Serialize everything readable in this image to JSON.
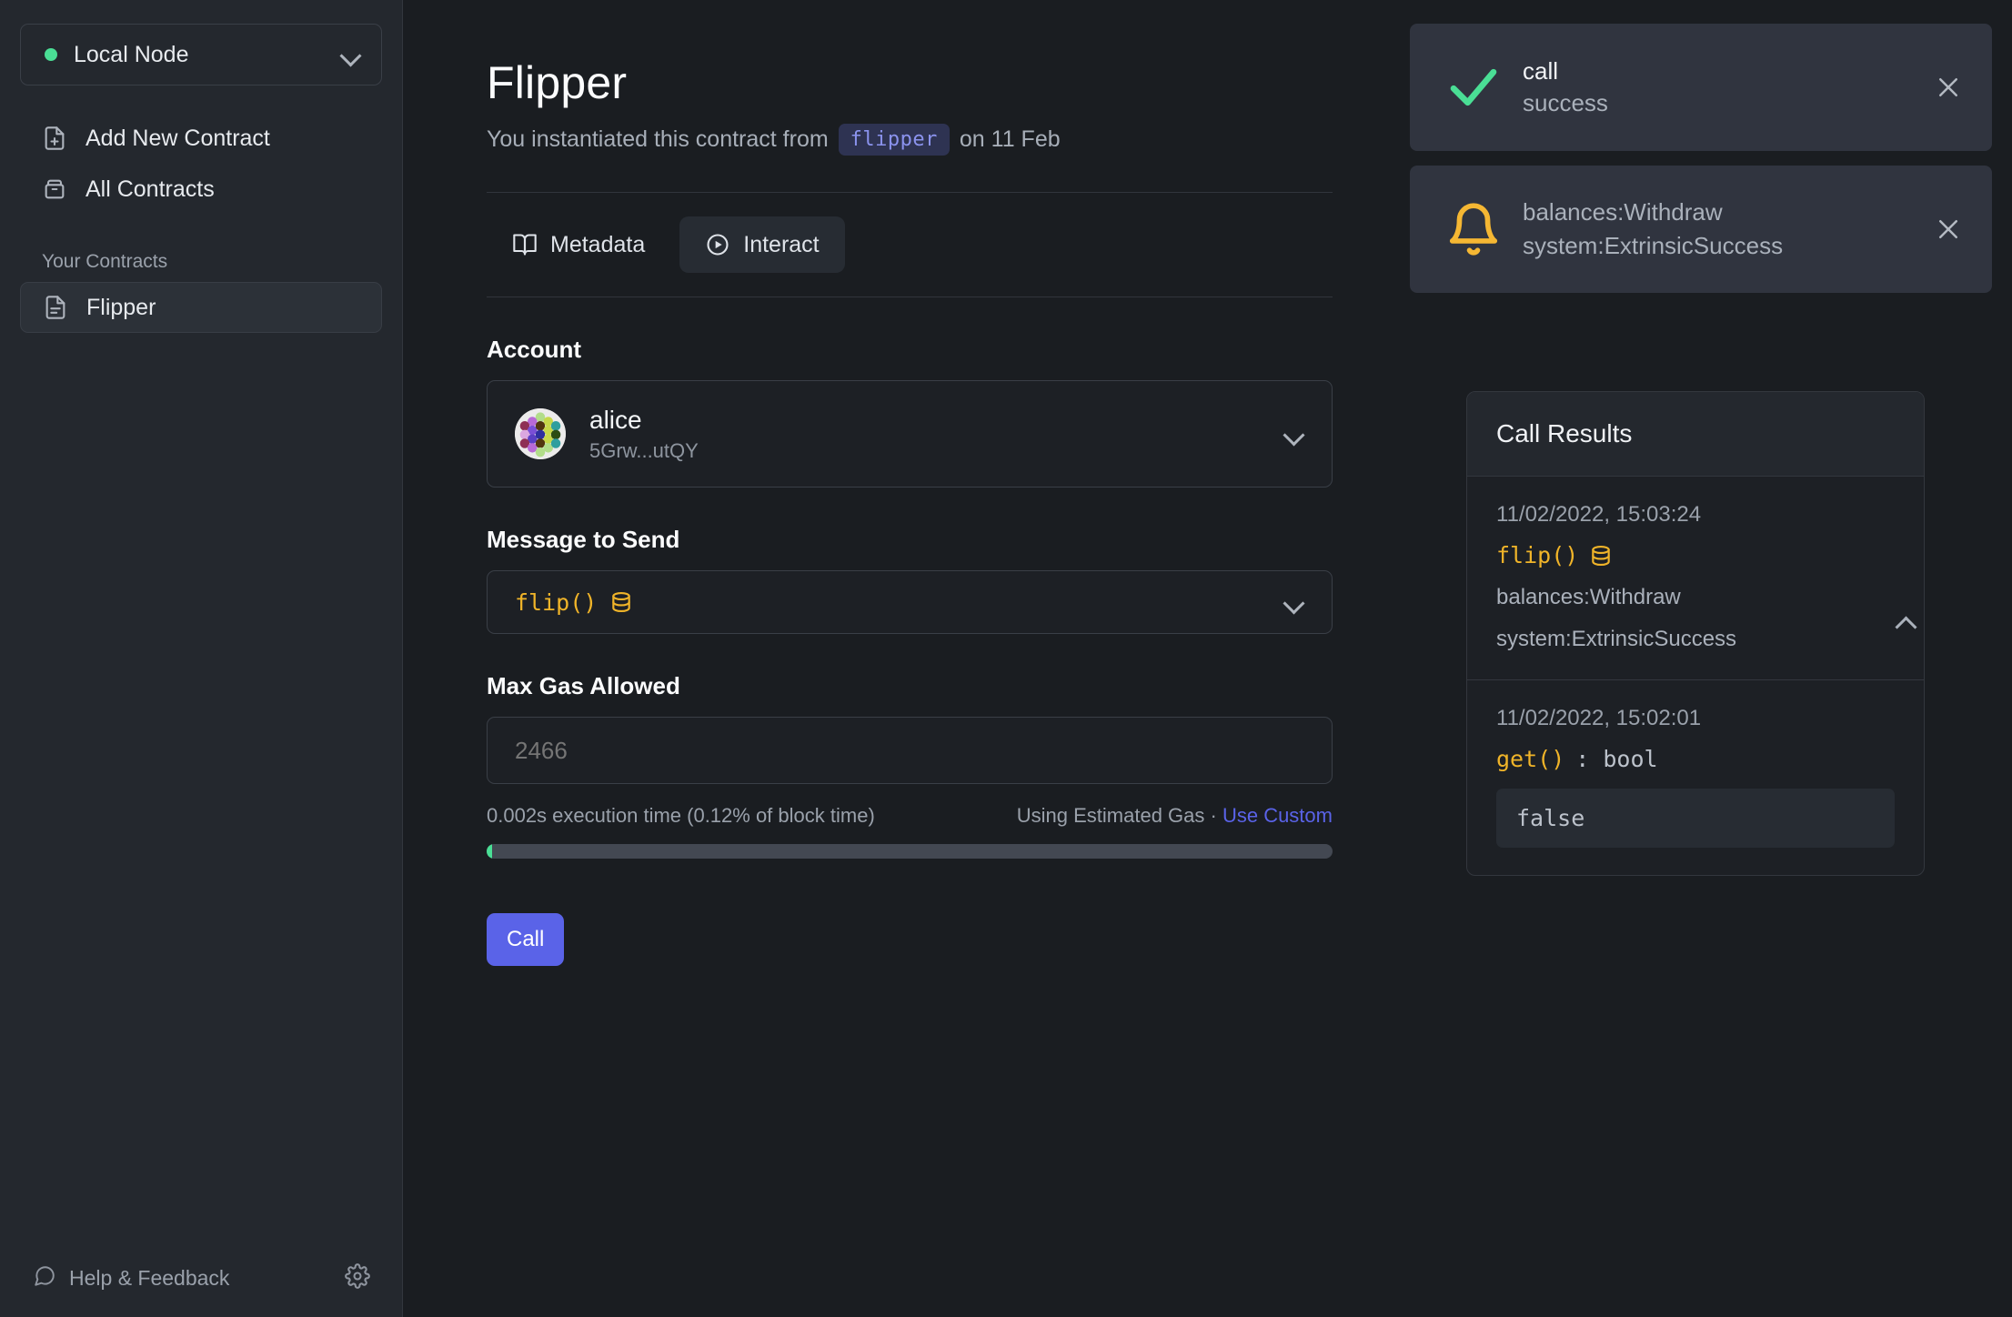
{
  "sidebar": {
    "node": {
      "label": "Local Node",
      "status_color": "#4ade95",
      "chevron_icon": "chevron-down-icon"
    },
    "nav": [
      {
        "label": "Add New Contract",
        "icon": "file-plus-icon"
      },
      {
        "label": "All Contracts",
        "icon": "archive-icon"
      }
    ],
    "section_label": "Your Contracts",
    "contracts": [
      {
        "label": "Flipper",
        "icon": "file-text-icon",
        "selected": true
      }
    ],
    "footer": {
      "help_label": "Help & Feedback",
      "help_icon": "message-square-icon",
      "settings_icon": "gear-icon"
    }
  },
  "header": {
    "title": "Flipper",
    "subtitle_before": "You instantiated this contract from",
    "subtitle_chip": "flipper",
    "subtitle_after": "on 11 Feb"
  },
  "tabs": [
    {
      "label": "Metadata",
      "icon": "book-icon",
      "active": false
    },
    {
      "label": "Interact",
      "icon": "play-circle-icon",
      "active": true
    }
  ],
  "form": {
    "account": {
      "label": "Account",
      "name": "alice",
      "address": "5Grw...utQY",
      "avatar_icon": "identicon-avatar",
      "chevron_icon": "chevron-down-icon"
    },
    "message": {
      "label": "Message to Send",
      "value": "flip()",
      "value_icon": "database-icon",
      "chevron_icon": "chevron-down-icon"
    },
    "gas": {
      "label": "Max Gas Allowed",
      "value": "2466",
      "placeholder": "2466",
      "exec_note": "0.002s execution time (0.12% of block time)",
      "estimate_note": "Using Estimated Gas ·",
      "custom_link": "Use Custom",
      "progress_percent": 0.12,
      "progress_fill_color": "#4ade95"
    },
    "submit_label": "Call"
  },
  "toasts": [
    {
      "icon": "check-icon",
      "icon_color": "#4ade95",
      "title": "call",
      "subtitle": "success",
      "close_icon": "close-icon"
    },
    {
      "icon": "bell-icon",
      "icon_color": "#f5b733",
      "line1": "balances:Withdraw",
      "line2": "system:ExtrinsicSuccess",
      "close_icon": "close-icon"
    }
  ],
  "results": {
    "title": "Call Results",
    "items": [
      {
        "time": "11/02/2022, 15:03:24",
        "call": "flip()",
        "call_icon": "database-icon",
        "return_type": "",
        "events": [
          "balances:Withdraw",
          "system:ExtrinsicSuccess"
        ],
        "output": "",
        "collapse_icon": "chevron-up-icon"
      },
      {
        "time": "11/02/2022, 15:02:01",
        "call": "get()",
        "return_type": ": bool",
        "events": [],
        "output": "false"
      }
    ]
  },
  "theme": {
    "accent": "#5a63e8",
    "success": "#4ade95",
    "warning": "#f0b429",
    "bg_main": "#1a1d21",
    "bg_sidebar": "#24282e",
    "bg_toast": "#30343f"
  }
}
